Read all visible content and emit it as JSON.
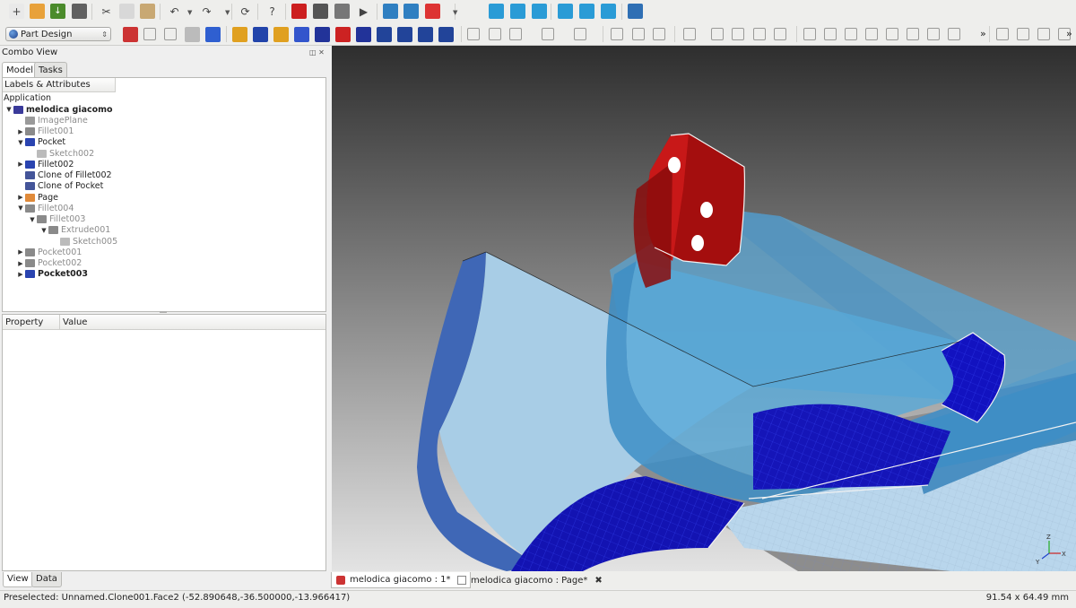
{
  "toolbar_main": {
    "buttons": [
      {
        "name": "new-file-icon",
        "color": "#e9e9e9",
        "glyph": "+"
      },
      {
        "name": "open-folder-icon",
        "color": "#e8a13a",
        "glyph": ""
      },
      {
        "name": "save-icon",
        "color": "#4b8b2b",
        "glyph": "↓"
      },
      {
        "name": "print-icon",
        "color": "#606060",
        "glyph": ""
      },
      {
        "name": "cut-icon",
        "color": "#eeeeec",
        "glyph": "✂"
      },
      {
        "name": "copy-icon",
        "color": "#d8d8d8",
        "glyph": ""
      },
      {
        "name": "paste-icon",
        "color": "#c8a873",
        "glyph": ""
      },
      {
        "name": "undo-icon",
        "color": "#eeeeec",
        "glyph": "↶"
      },
      {
        "name": "redo-icon",
        "color": "#eeeeec",
        "glyph": "↷"
      },
      {
        "name": "refresh-icon",
        "color": "#eeeeec",
        "glyph": "⟳"
      },
      {
        "name": "whats-this-icon",
        "color": "#eeeeec",
        "glyph": "?"
      },
      {
        "name": "macro-record-icon",
        "color": "#cc1f1f",
        "glyph": ""
      },
      {
        "name": "macro-stop-icon",
        "color": "#555555",
        "glyph": ""
      },
      {
        "name": "macro-edit-icon",
        "color": "#777777",
        "glyph": ""
      },
      {
        "name": "macro-run-icon",
        "color": "#eeeeec",
        "glyph": "▶"
      },
      {
        "name": "view-fit-all-icon",
        "color": "#2f7fc1",
        "glyph": ""
      },
      {
        "name": "view-fit-selection-icon",
        "color": "#2f7fc1",
        "glyph": ""
      },
      {
        "name": "draw-style-icon",
        "color": "#dd3333",
        "glyph": ""
      },
      {
        "name": "view-isometric-icon",
        "color": "#eeeeec",
        "glyph": ""
      },
      {
        "name": "view-front-icon",
        "color": "#2a9bd6",
        "glyph": ""
      },
      {
        "name": "view-top-icon",
        "color": "#2a9bd6",
        "glyph": ""
      },
      {
        "name": "view-right-icon",
        "color": "#2a9bd6",
        "glyph": ""
      },
      {
        "name": "view-rear-icon",
        "color": "#2a9bd6",
        "glyph": ""
      },
      {
        "name": "view-bottom-icon",
        "color": "#2a9bd6",
        "glyph": ""
      },
      {
        "name": "view-left-icon",
        "color": "#2a9bd6",
        "glyph": ""
      },
      {
        "name": "measure-distance-icon",
        "color": "#2f6fb4",
        "glyph": ""
      }
    ]
  },
  "toolbar_partdesign": {
    "workbench_label": "Part Design",
    "overflow_1": "»",
    "overflow_2": "»",
    "buttons": [
      {
        "name": "create-body-icon",
        "color": "#cc3333"
      },
      {
        "name": "export-icon",
        "color": "#eeeeec"
      },
      {
        "name": "import-icon",
        "color": "#eeeeec"
      },
      {
        "name": "view-image-icon",
        "color": "#bbbbbb"
      },
      {
        "name": "part-box-icon",
        "color": "#2f5fd0"
      },
      {
        "name": "pad-icon",
        "color": "#e0a020"
      },
      {
        "name": "pocket-icon",
        "color": "#2244aa"
      },
      {
        "name": "revolution-icon",
        "color": "#e0a020"
      },
      {
        "name": "groove-icon",
        "color": "#3355cc"
      },
      {
        "name": "fillet-icon",
        "color": "#223399"
      },
      {
        "name": "chamfer-icon",
        "color": "#cc2222"
      },
      {
        "name": "draft-icon",
        "color": "#223399"
      },
      {
        "name": "mirrored-icon",
        "color": "#224499"
      },
      {
        "name": "linear-pattern-icon",
        "color": "#224499"
      },
      {
        "name": "polar-pattern-icon",
        "color": "#224499"
      },
      {
        "name": "multi-transform-icon",
        "color": "#224499"
      },
      {
        "name": "sketch-point-icon",
        "color": "#eeeeec"
      },
      {
        "name": "sketch-line-icon",
        "color": "#eeeeec"
      },
      {
        "name": "sketch-arc-icon",
        "color": "#eeeeec"
      },
      {
        "name": "sketch-circle-icon",
        "color": "#eeeeec"
      },
      {
        "name": "sketch-conic-icon",
        "color": "#eeeeec"
      },
      {
        "name": "sketch-polyline-icon",
        "color": "#eeeeec"
      },
      {
        "name": "sketch-rectangle-icon",
        "color": "#eeeeec"
      },
      {
        "name": "sketch-polygon-icon",
        "color": "#eeeeec"
      },
      {
        "name": "sketch-slot-icon",
        "color": "#eeeeec"
      },
      {
        "name": "sketch-fillet-icon",
        "color": "#eeeeec"
      },
      {
        "name": "sketch-trim-icon",
        "color": "#eeeeec"
      },
      {
        "name": "sketch-external-icon",
        "color": "#eeeeec"
      },
      {
        "name": "sketch-construction-icon",
        "color": "#eeeeec"
      },
      {
        "name": "constraint-coincident-icon",
        "color": "#eeeeec"
      },
      {
        "name": "constraint-point-on-object-icon",
        "color": "#eeeeec"
      },
      {
        "name": "constraint-vertical-icon",
        "color": "#eeeeec"
      },
      {
        "name": "constraint-horizontal-icon",
        "color": "#eeeeec"
      },
      {
        "name": "constraint-parallel-icon",
        "color": "#eeeeec"
      },
      {
        "name": "constraint-perpendicular-icon",
        "color": "#eeeeec"
      },
      {
        "name": "constraint-tangent-icon",
        "color": "#eeeeec"
      },
      {
        "name": "constraint-equal-icon",
        "color": "#eeeeec"
      },
      {
        "name": "constraint-symmetric-icon",
        "color": "#eeeeec"
      },
      {
        "name": "constraint-lock-icon",
        "color": "#eeeeec"
      },
      {
        "name": "constraint-horizontal-distance-icon",
        "color": "#eeeeec"
      },
      {
        "name": "constraint-vertical-distance-icon",
        "color": "#eeeeec"
      }
    ]
  },
  "combo_view": {
    "title": "Combo View",
    "tabs": [
      "Model",
      "Tasks"
    ],
    "tree_header": "Labels & Attributes",
    "tree_root": "Application",
    "tree": [
      {
        "label": "melodica giacomo",
        "level": 0,
        "expander": "▼",
        "icon": "#3a3a9a",
        "style": "bold"
      },
      {
        "label": "ImagePlane",
        "level": 1,
        "expander": "",
        "icon": "#9a9a9a",
        "style": "dim"
      },
      {
        "label": "Fillet001",
        "level": 1,
        "expander": "▶",
        "icon": "#8a8a8a",
        "style": "dim"
      },
      {
        "label": "Pocket",
        "level": 1,
        "expander": "▼",
        "icon": "#2a44b0",
        "style": "normal"
      },
      {
        "label": "Sketch002",
        "level": 2,
        "expander": "",
        "icon": "#bbbbbb",
        "style": "dim"
      },
      {
        "label": "Fillet002",
        "level": 1,
        "expander": "▶",
        "icon": "#2a44b0",
        "style": "normal"
      },
      {
        "label": "Clone of Fillet002",
        "level": 1,
        "expander": "",
        "icon": "#445599",
        "style": "normal"
      },
      {
        "label": "Clone of Pocket",
        "level": 1,
        "expander": "",
        "icon": "#445599",
        "style": "normal"
      },
      {
        "label": "Page",
        "level": 1,
        "expander": "▶",
        "icon": "#e08a3a",
        "style": "normal"
      },
      {
        "label": "Fillet004",
        "level": 1,
        "expander": "▼",
        "icon": "#8a8a8a",
        "style": "dim"
      },
      {
        "label": "Fillet003",
        "level": 2,
        "expander": "▼",
        "icon": "#8a8a8a",
        "style": "dim"
      },
      {
        "label": "Extrude001",
        "level": 3,
        "expander": "▼",
        "icon": "#8a8a8a",
        "style": "dim"
      },
      {
        "label": "Sketch005",
        "level": 4,
        "expander": "",
        "icon": "#bbbbbb",
        "style": "dim"
      },
      {
        "label": "Pocket001",
        "level": 1,
        "expander": "▶",
        "icon": "#8a8a8a",
        "style": "dim"
      },
      {
        "label": "Pocket002",
        "level": 1,
        "expander": "▶",
        "icon": "#8a8a8a",
        "style": "dim"
      },
      {
        "label": "Pocket003",
        "level": 1,
        "expander": "▶",
        "icon": "#2a44b0",
        "style": "bold"
      }
    ],
    "property_header": "Property",
    "value_header": "Value",
    "bottom_tabs": [
      "View",
      "Data"
    ]
  },
  "document_tabs": [
    {
      "label": "melodica giacomo : 1*",
      "active": true
    },
    {
      "label": "melodica giacomo : Page*",
      "active": false
    }
  ],
  "status": {
    "message": "Preselected: Unnamed.Clone001.Face2 (-52.890648,-36.500000,-13.966417)",
    "dimensions": "91.54 x 64.49 mm"
  },
  "view_axes": {
    "x": "X",
    "y": "Y",
    "z": "Z"
  }
}
